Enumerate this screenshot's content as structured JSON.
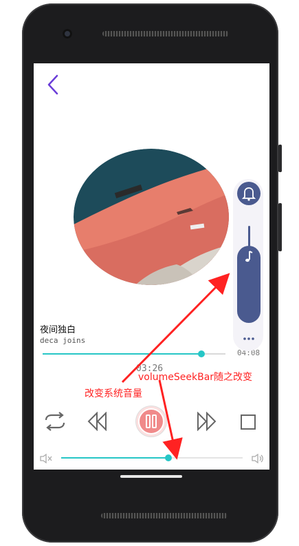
{
  "screen": {
    "back_icon": "chevron-left-icon",
    "song": {
      "title": "夜间独白",
      "artist": "deca joins"
    },
    "progress": {
      "current_time": "03:26",
      "total_time": "04:08",
      "fraction": 0.87
    },
    "controls": {
      "repeat_icon": "repeat-icon",
      "prev_icon": "rewind-icon",
      "play_pause_icon": "pause-icon",
      "next_icon": "fast-forward-icon",
      "stop_icon": "stop-square-icon"
    },
    "volume_bar": {
      "fraction": 0.59,
      "mute_icon": "volume-mute-icon",
      "loud_icon": "volume-up-icon"
    },
    "system_volume_panel": {
      "ring_icon": "bell-icon",
      "music_icon": "music-note-icon",
      "more_icon": "more-dots-icon",
      "level_fraction": 0.8
    }
  },
  "annotations": {
    "label_1": "改变系统音量",
    "label_2": "volumeSeekBar随之改变"
  },
  "colors": {
    "accent_teal": "#26c6c6",
    "panel_blue": "#4a5a8f",
    "back_purple": "#6a3dd8",
    "pause_pink": "#f08a8a",
    "annotation_red": "#ff2222"
  }
}
